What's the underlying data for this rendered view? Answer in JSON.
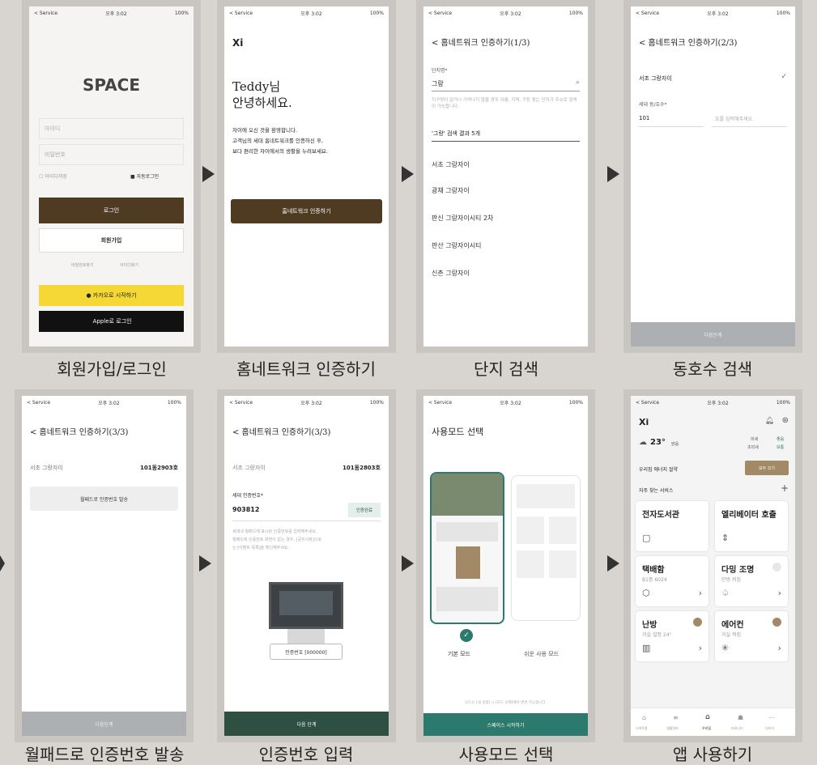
{
  "status_bar": {
    "carrier": "< Service",
    "time": "오후 3:02",
    "battery": "100%"
  },
  "captions": [
    "회원가입/로그인",
    "홈네트워크 인증하기",
    "단지 검색",
    "동호수 검색",
    "월패드로 인증번호 발송",
    "인증번호 입력",
    "사용모드 선택",
    "앱 사용하기"
  ],
  "login": {
    "logo": "SPACE",
    "id_placeholder": "아이디",
    "pw_placeholder": "비밀번호",
    "save_id": "아이디저장",
    "auto_login": "자동로그인",
    "login_button": "로그인",
    "signup_button": "회원가입",
    "find_pw": "비밀번호찾기",
    "find_id": "아이디찾기",
    "kakao_button": "카카오로 시작하기",
    "apple_button": "Apple로 로그인"
  },
  "auth_intro": {
    "logo": "Xi",
    "greeting_line1": "Teddy님",
    "greeting_line2": "안녕하세요.",
    "body_line1": "자이에 오신 것을 환영합니다.",
    "body_line2": "고객님의 세대 홈네트워크를 인증하신 후,",
    "body_line3": "보다 편리한 자이에서의 생활을 누려보세요.",
    "button": "홈네트워크 인증하기"
  },
  "complex_search": {
    "title": "< 홈네트워크 인증하기(1/3)",
    "field_label": "단지명*",
    "query": "그랑",
    "hint": "지구명이 없거나 기억나지 않을 경우 이름, 지역, 구등 찾는 단지가 주소로 검색이 가능합니다.",
    "result_header": "'그랑' 검색 결과 5개",
    "results": [
      "서초 그랑자이",
      "광채 그랑자이",
      "판신 그랑자이시티 2차",
      "판산 그랑자이시티",
      "신촌 그랑자이"
    ]
  },
  "unit_search": {
    "title": "< 홈네트워크 인증하기(2/3)",
    "complex": "서초 그랑자이",
    "unit_label": "세대 동/호수*",
    "dong": "101",
    "ho_placeholder": "호를 입력해주세요.",
    "next_button": "다음단계"
  },
  "wallpad_send": {
    "title": "< 홈네트워크 인증하기(3/3)",
    "complex": "서초 그랑자이",
    "unit": "101동2903호",
    "send_button": "월패드로 인증번호 발송",
    "next_button": "다음단계"
  },
  "code_input": {
    "title": "< 홈네트워크 인증하기(3/3)",
    "complex": "서초 그랑자이",
    "unit": "101동2803호",
    "code_label": "세대 인증번호*",
    "code_value": "903812",
    "verify_badge": "인증완료",
    "help_line1": "세대내 월패드에 표시된 인증번호를 입력해주세요.",
    "help_line2": "월패드에 인증번호 화면이 없는 경우, [공지사항]으로",
    "help_line3": "는 [이벤트 목록]을 확인해주세요.",
    "wallpad_label": "인증번호 [000000]",
    "next_button": "다음 단계"
  },
  "mode_select": {
    "title": "사용모드 선택",
    "mode_basic": "기본 모드",
    "mode_easy": "쉬운 사용 모드",
    "footnote": "모드는 [내 설정] > [모드 선택]에서 변경 가능합니다.",
    "start_button": "스페이스 시작하기"
  },
  "home": {
    "logo": "Xi",
    "temp": "23°",
    "weather": "맑음",
    "dust_label": "미세",
    "dust_value": "좋음",
    "ultra_label": "초미세",
    "ultra_value": "보통",
    "energy_label": "우리집 에너지 절약",
    "energy_btn": "모두 끄기",
    "services_label": "자주 찾는 서비스",
    "tiles": [
      {
        "title": "전자도서관",
        "sub": ""
      },
      {
        "title": "엘리베이터 호출",
        "sub": ""
      },
      {
        "title": "택배함",
        "sub": "B1층 6024"
      },
      {
        "title": "다밍 조명",
        "sub": "안방 커짐"
      },
      {
        "title": "난방",
        "sub": "거실 설정 24°"
      },
      {
        "title": "에어컨",
        "sub": "거실 켜짐"
      }
    ],
    "nav": [
      "스마트홈",
      "생활정보",
      "우리집",
      "커뮤니티",
      "더보기"
    ]
  },
  "colors": {
    "brown": "#4e3b22",
    "kakao": "#f5d835",
    "green": "#2e5043",
    "teal": "#2b7a6d",
    "dot": "#a28a67"
  }
}
